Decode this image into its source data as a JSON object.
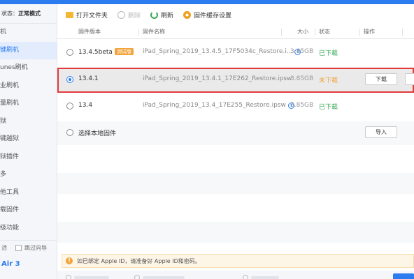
{
  "sidebar": {
    "status_prefix": "状态：",
    "status_value": "正常模式",
    "items": [
      {
        "label": "机",
        "active": false
      },
      {
        "label": "键刷机",
        "active": true
      },
      {
        "label": "unes刷机",
        "active": false
      },
      {
        "label": "业刷机",
        "active": false
      },
      {
        "label": "量刷机",
        "active": false
      },
      {
        "label": "狱",
        "active": false
      },
      {
        "label": "键越狱",
        "active": false
      },
      {
        "label": "狱插件",
        "active": false
      },
      {
        "label": "多",
        "active": false
      },
      {
        "label": "他工具",
        "active": false
      },
      {
        "label": "载固件",
        "active": false
      },
      {
        "label": "级功能",
        "active": false
      }
    ],
    "partial_text": "活",
    "skip_label": "跳过向导",
    "device": "Air 3"
  },
  "toolbar": {
    "open_folder": "打开文件夹",
    "delete": "删除",
    "refresh": "刷新",
    "cache_settings": "固件缓存设置"
  },
  "table": {
    "headers": {
      "version": "固件版本",
      "name": "固件名称",
      "size": "大小",
      "status": "状态",
      "action": "操作"
    },
    "rows": [
      {
        "version": "13.4.5beta",
        "badge": "测试版",
        "name": "iPad_Spring_2019_13.4.5_17F5034c_Restore.i...",
        "size": "3.85GB",
        "status": "已下载",
        "status_type": "ok",
        "checked": false
      },
      {
        "version": "13.4.1",
        "name": "iPad_Spring_2019_13.4.1_17E262_Restore.ipsw",
        "size": "3.85GB",
        "status": "未下载",
        "status_type": "no",
        "checked": true,
        "action": "下载"
      },
      {
        "version": "13.4",
        "name": "iPad_Spring_2019_13.4_17E255_Restore.ipsw",
        "size": "3.85GB",
        "status": "已下载",
        "status_type": "ok",
        "checked": false
      }
    ],
    "local_option": "选择本地固件",
    "import_label": "导入"
  },
  "notice": {
    "icon": "!",
    "text": "如已绑定 Apple ID，请准备好 Apple ID和密码。"
  },
  "colors": {
    "accent": "#2c7cf0",
    "ok": "#3aa856",
    "warn": "#f2a33a",
    "highlight": "#e03a3a"
  }
}
